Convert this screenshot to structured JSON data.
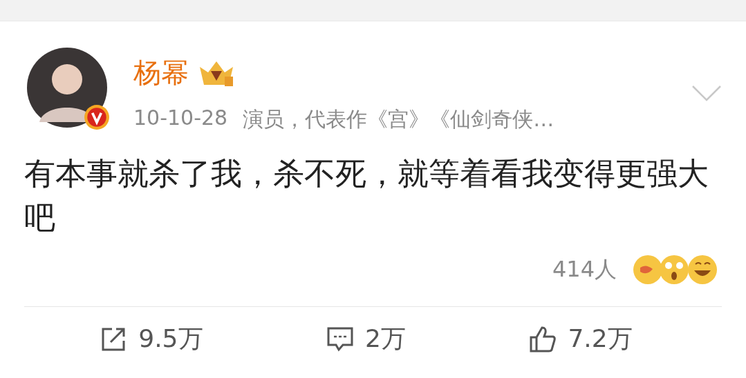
{
  "author": {
    "name": "杨幂",
    "verified": true
  },
  "meta": {
    "date": "10-10-28",
    "bio": "演员，代表作《宫》《仙剑奇侠…"
  },
  "post": {
    "text": "有本事就杀了我，杀不死，就等着看我变得更强大吧"
  },
  "reactions": {
    "count": "414人"
  },
  "actions": [
    {
      "kind": "repost",
      "count": "9.5万"
    },
    {
      "kind": "comment",
      "count": "2万"
    },
    {
      "kind": "like",
      "count": "7.2万"
    }
  ]
}
